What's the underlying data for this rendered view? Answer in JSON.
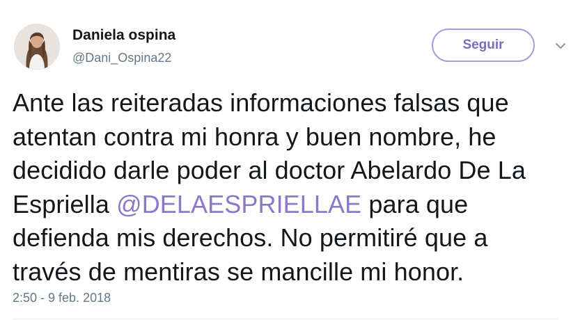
{
  "author": {
    "display_name": "Daniela ospina",
    "handle": "@Dani_Ospina22"
  },
  "follow_button": {
    "label": "Seguir"
  },
  "menu": {
    "icon": "chevron-down-icon"
  },
  "tweet": {
    "text_before_mention": "Ante las reiteradas informaciones falsas que atentan contra mi honra y buen nombre, he decidido darle poder al doctor Abelardo De La Espriella ",
    "mention": "@DELAESPRIELLAE",
    "text_after_mention": " para que defienda mis derechos. No permitiré que a través de mentiras se mancille mi honor.",
    "timestamp": "2:50 - 9 feb. 2018"
  },
  "colors": {
    "mention": "#8b78c9",
    "follow_border": "#a99bd6",
    "follow_text": "#7d6bbf",
    "secondary_text": "#657786"
  }
}
